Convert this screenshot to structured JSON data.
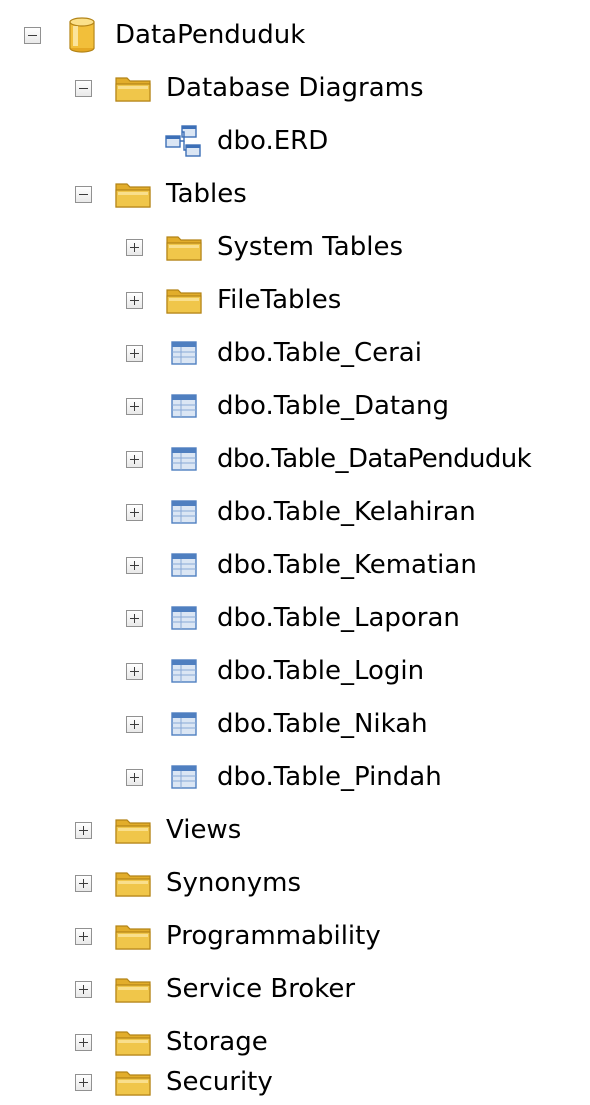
{
  "tree": {
    "database": {
      "label": "DataPenduduk",
      "icon": "database-cylinder-icon",
      "expanded": true
    },
    "database_diagrams": {
      "label": "Database Diagrams",
      "icon": "folder-icon",
      "expanded": true
    },
    "diagrams": [
      {
        "label": "dbo.ERD",
        "icon": "diagram-icon"
      }
    ],
    "tables_folder": {
      "label": "Tables",
      "icon": "folder-icon",
      "expanded": true
    },
    "table_subfolders": [
      {
        "label": "System Tables",
        "icon": "folder-icon",
        "expanded": false
      },
      {
        "label": "FileTables",
        "icon": "folder-icon",
        "expanded": false
      }
    ],
    "tables": [
      {
        "label": "dbo.Table_Cerai",
        "icon": "table-icon",
        "expanded": false
      },
      {
        "label": "dbo.Table_Datang",
        "icon": "table-icon",
        "expanded": false
      },
      {
        "label": "dbo.Table_DataPenduduk",
        "icon": "table-icon",
        "expanded": false
      },
      {
        "label": "dbo.Table_Kelahiran",
        "icon": "table-icon",
        "expanded": false
      },
      {
        "label": "dbo.Table_Kematian",
        "icon": "table-icon",
        "expanded": false
      },
      {
        "label": "dbo.Table_Laporan",
        "icon": "table-icon",
        "expanded": false
      },
      {
        "label": "dbo.Table_Login",
        "icon": "table-icon",
        "expanded": false
      },
      {
        "label": "dbo.Table_Nikah",
        "icon": "table-icon",
        "expanded": false
      },
      {
        "label": "dbo.Table_Pindah",
        "icon": "table-icon",
        "expanded": false
      }
    ],
    "other_folders": [
      {
        "label": "Views",
        "icon": "folder-icon",
        "expanded": false
      },
      {
        "label": "Synonyms",
        "icon": "folder-icon",
        "expanded": false
      },
      {
        "label": "Programmability",
        "icon": "folder-icon",
        "expanded": false
      },
      {
        "label": "Service Broker",
        "icon": "folder-icon",
        "expanded": false
      },
      {
        "label": "Storage",
        "icon": "folder-icon",
        "expanded": false
      },
      {
        "label": "Security",
        "icon": "folder-icon",
        "expanded": false
      }
    ]
  },
  "colors": {
    "folder_fill": "#f0c64a",
    "folder_tab": "#e2ad2b",
    "folder_edge": "#b38417",
    "database_fill": "#f2bf3a",
    "table_fill": "#dbe6f4",
    "table_edge": "#4f7fc0",
    "diagram_blue": "#3c6fb7"
  }
}
